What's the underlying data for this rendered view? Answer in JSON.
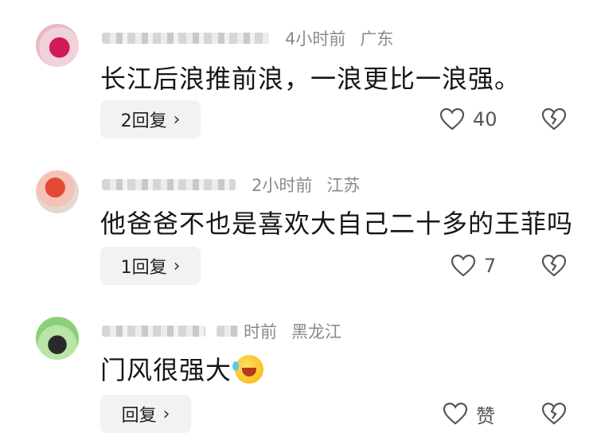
{
  "comments": [
    {
      "time": "4小时前",
      "location": "广东",
      "text": "长江后浪推前浪，一浪更比一浪强。",
      "reply_label": "2回复",
      "like_count": "40"
    },
    {
      "time": "2小时前",
      "location": "江苏",
      "text": "他爸爸不也是喜欢大自己二十多的王菲吗",
      "reply_label": "1回复",
      "like_count": "7"
    },
    {
      "time": "时前",
      "location": "黑龙江",
      "text": "门风很强大",
      "reply_label": "回复",
      "like_count": "赞"
    }
  ],
  "icons": {
    "reply_chevron": "chevron-right-icon",
    "like": "heart-icon",
    "dislike": "broken-heart-icon",
    "emoji": "laughing-tears-emoji"
  },
  "colors": {
    "meta_text": "#8a8a8a",
    "reply_bg": "#f2f2f2",
    "icon": "#555555"
  }
}
